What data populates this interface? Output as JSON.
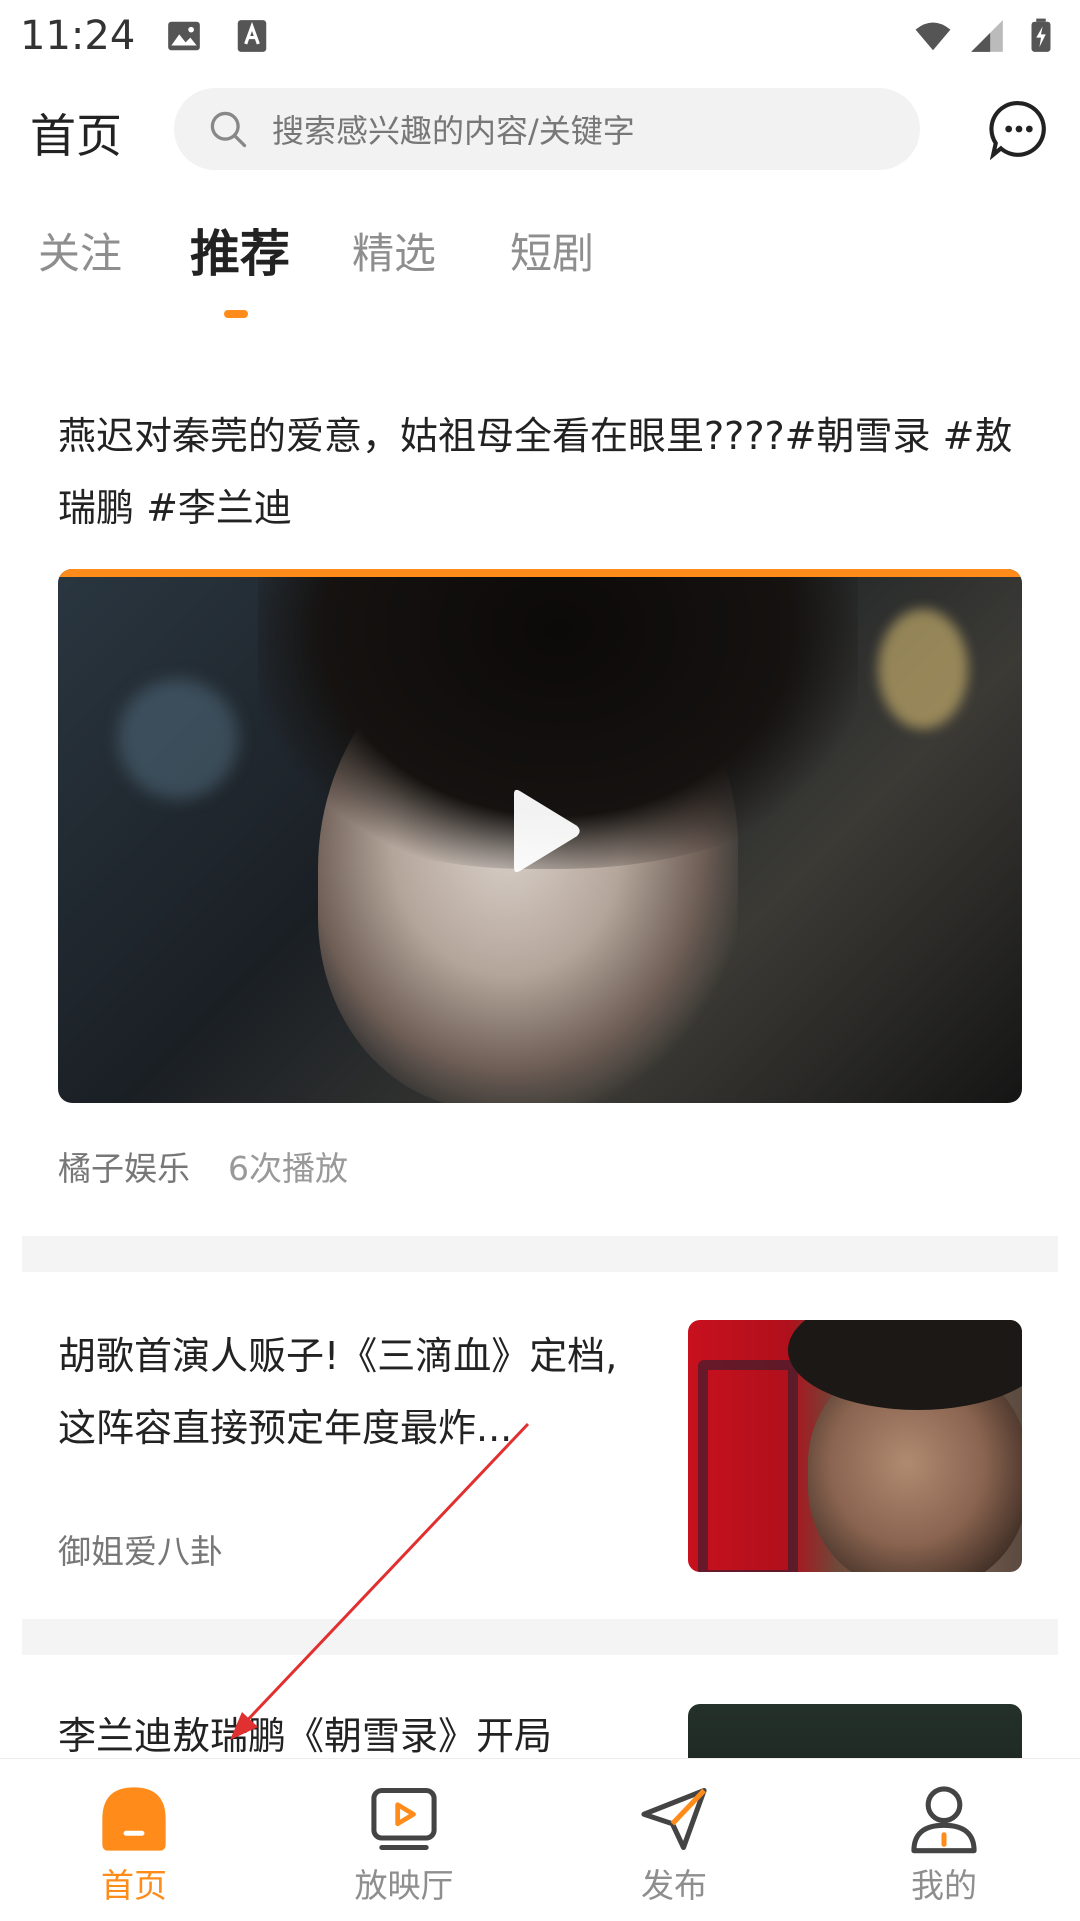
{
  "status_bar": {
    "time": "11:24"
  },
  "header": {
    "title": "首页",
    "search_placeholder": "搜索感兴趣的内容/关键字",
    "chat_icon": "chat-bubble-icon"
  },
  "tabs": [
    {
      "label": "关注",
      "active": false
    },
    {
      "label": "推荐",
      "active": true
    },
    {
      "label": "精选",
      "active": false
    },
    {
      "label": "短剧",
      "active": false
    }
  ],
  "feed": [
    {
      "title": "燕迟对秦莞的爱意，姑祖母全看在眼里????#朝雪录 #敖瑞鹏 #李兰迪",
      "source": "橘子娱乐",
      "plays": "6次播放"
    },
    {
      "title": "胡歌首演人贩子!《三滴血》定档,这阵容直接预定年度最炸...",
      "source": "御姐爱八卦"
    },
    {
      "title": "李兰迪敖瑞鹏《朝雪录》开局"
    }
  ],
  "bottom_nav": [
    {
      "label": "首页",
      "icon": "home-icon",
      "active": true
    },
    {
      "label": "放映厅",
      "icon": "screening-room-icon",
      "active": false
    },
    {
      "label": "发布",
      "icon": "publish-icon",
      "active": false
    },
    {
      "label": "我的",
      "icon": "profile-icon",
      "active": false
    }
  ],
  "colors": {
    "accent": "#ff8c1a",
    "divider": "#f4f4f4",
    "arrow": "#e03030"
  }
}
